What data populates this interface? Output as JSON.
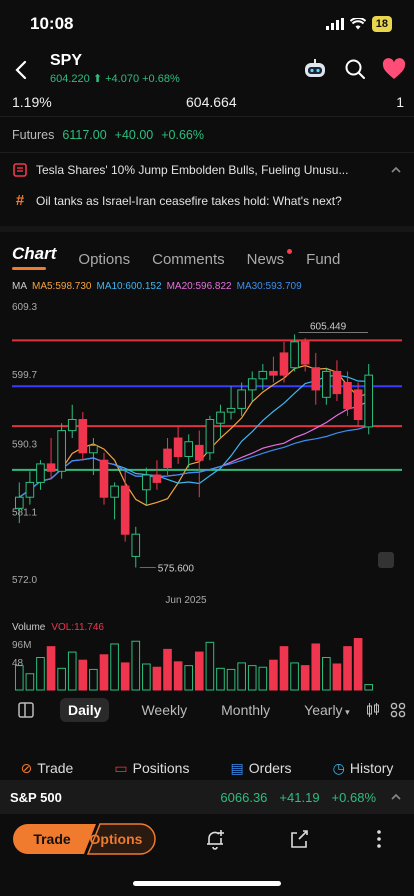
{
  "status": {
    "time": "10:08",
    "battery": "18"
  },
  "header": {
    "ticker": "SPY",
    "price": "604.220",
    "change": "+4.070",
    "change_pct": "+0.68%",
    "metric_left": "1.19%",
    "metric_mid": "604.664",
    "metric_right": "1"
  },
  "futures": {
    "label": "Futures",
    "price": "6117.00",
    "change": "+40.00",
    "change_pct": "+0.66%"
  },
  "news": [
    {
      "text": "Tesla Shares' 10% Jump Embolden Bulls, Fueling Unusu..."
    },
    {
      "text": "Oil tanks as Israel-Iran ceasefire takes hold: What's next?"
    }
  ],
  "tabs": [
    "Chart",
    "Options",
    "Comments",
    "News",
    "Fund"
  ],
  "ma": {
    "label": "MA",
    "ma5": "MA5:598.730",
    "ma10": "MA10:600.152",
    "ma20": "MA20:596.822",
    "ma30": "MA30:593.709",
    "colors": {
      "ma5": "#f5a340",
      "ma10": "#3fb6f0",
      "ma20": "#e86fe0",
      "ma30": "#3c8ef0"
    }
  },
  "chart_data": {
    "type": "candlestick",
    "y_ticks": [
      "609.3",
      "599.7",
      "590.3",
      "581.1",
      "572.0"
    ],
    "ylim": [
      572.0,
      609.3
    ],
    "x_label": "Jun 2025",
    "annotations": {
      "high": "605.449",
      "low": "575.600"
    },
    "candles": [
      {
        "o": 582.5,
        "h": 586,
        "l": 580.5,
        "c": 584
      },
      {
        "o": 584,
        "h": 587.5,
        "l": 583,
        "c": 586
      },
      {
        "o": 586,
        "h": 589,
        "l": 585,
        "c": 588.5
      },
      {
        "o": 588.5,
        "h": 592,
        "l": 586.5,
        "c": 587.5
      },
      {
        "o": 587.5,
        "h": 594,
        "l": 586.5,
        "c": 593
      },
      {
        "o": 593,
        "h": 596.5,
        "l": 592,
        "c": 594.5
      },
      {
        "o": 594.5,
        "h": 595.5,
        "l": 589,
        "c": 590
      },
      {
        "o": 590,
        "h": 592,
        "l": 587,
        "c": 591
      },
      {
        "o": 589,
        "h": 590,
        "l": 583,
        "c": 584
      },
      {
        "o": 584,
        "h": 586,
        "l": 581,
        "c": 585.5
      },
      {
        "o": 585.5,
        "h": 587.5,
        "l": 578,
        "c": 579
      },
      {
        "o": 576,
        "h": 580,
        "l": 574.5,
        "c": 579
      },
      {
        "o": 585,
        "h": 588,
        "l": 583,
        "c": 587
      },
      {
        "o": 587,
        "h": 589,
        "l": 585,
        "c": 586
      },
      {
        "o": 590.5,
        "h": 592,
        "l": 587,
        "c": 588
      },
      {
        "o": 592,
        "h": 593.5,
        "l": 588.5,
        "c": 589.5
      },
      {
        "o": 589.5,
        "h": 592.5,
        "l": 588,
        "c": 591.5
      },
      {
        "o": 591,
        "h": 593,
        "l": 584,
        "c": 589
      },
      {
        "o": 590,
        "h": 595,
        "l": 589,
        "c": 594.5
      },
      {
        "o": 594,
        "h": 596.5,
        "l": 592,
        "c": 595.5
      },
      {
        "o": 595.5,
        "h": 599,
        "l": 594.5,
        "c": 596
      },
      {
        "o": 596,
        "h": 599.5,
        "l": 595,
        "c": 598.5
      },
      {
        "o": 598.5,
        "h": 601,
        "l": 597,
        "c": 600
      },
      {
        "o": 600,
        "h": 602,
        "l": 598.5,
        "c": 601
      },
      {
        "o": 601,
        "h": 603,
        "l": 599.5,
        "c": 600.5
      },
      {
        "o": 603.5,
        "h": 605,
        "l": 599.5,
        "c": 600.5
      },
      {
        "o": 601.5,
        "h": 606,
        "l": 601,
        "c": 605
      },
      {
        "o": 605,
        "h": 605.5,
        "l": 601,
        "c": 602
      },
      {
        "o": 601.5,
        "h": 603.5,
        "l": 596.5,
        "c": 598.5
      },
      {
        "o": 597.5,
        "h": 601.5,
        "l": 596.5,
        "c": 601
      },
      {
        "o": 601,
        "h": 602.5,
        "l": 597,
        "c": 598
      },
      {
        "o": 599.5,
        "h": 601,
        "l": 595,
        "c": 596
      },
      {
        "o": 598.5,
        "h": 599.5,
        "l": 593.5,
        "c": 594.5
      },
      {
        "o": 593.5,
        "h": 602,
        "l": 592.5,
        "c": 600.5
      }
    ],
    "level_lines": [
      {
        "y": 605.2,
        "color": "#e03340"
      },
      {
        "y": 599.0,
        "color": "#3b3bff"
      },
      {
        "y": 593.6,
        "color": "#e03340"
      },
      {
        "y": 587.7,
        "color": "#2ebd7e"
      }
    ],
    "colors": {
      "up": "#2ebd7e",
      "down": "#f0364e"
    }
  },
  "volume": {
    "label": "Volume",
    "vol": "VOL:11.746",
    "ticks": [
      "96M",
      "48"
    ],
    "max": 96,
    "values": [
      45,
      30,
      60,
      80,
      40,
      70,
      55,
      38,
      65,
      85,
      50,
      90,
      48,
      42,
      75,
      52,
      45,
      70,
      88,
      40,
      38,
      50,
      45,
      42,
      55,
      80,
      50,
      45,
      85,
      60,
      48,
      80,
      95,
      10
    ]
  },
  "periods": [
    "Daily",
    "Weekly",
    "Monthly",
    "Yearly"
  ],
  "bottom_tabs": [
    "Trade",
    "Positions",
    "Orders",
    "History"
  ],
  "index": {
    "name": "S&P 500",
    "price": "6066.36",
    "change": "+41.19",
    "change_pct": "+0.68%"
  },
  "actions": {
    "trade": "Trade",
    "options": "Options"
  }
}
